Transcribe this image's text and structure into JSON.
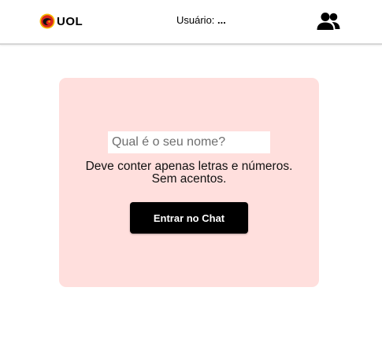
{
  "header": {
    "logo_text": "UOL",
    "user_label": "Usuário:",
    "user_value": "...",
    "people_icon": "people-group-icon"
  },
  "login": {
    "name_placeholder": "Qual é o seu nome?",
    "name_value": "",
    "hint_line1": "Deve conter apenas letras e números.",
    "hint_line2": "Sem acentos.",
    "enter_label": "Entrar no Chat"
  },
  "colors": {
    "card_background": "#ffdfdd",
    "button_background": "#000000",
    "logo_red": "#d9261c",
    "logo_yellow": "#f5b800"
  }
}
